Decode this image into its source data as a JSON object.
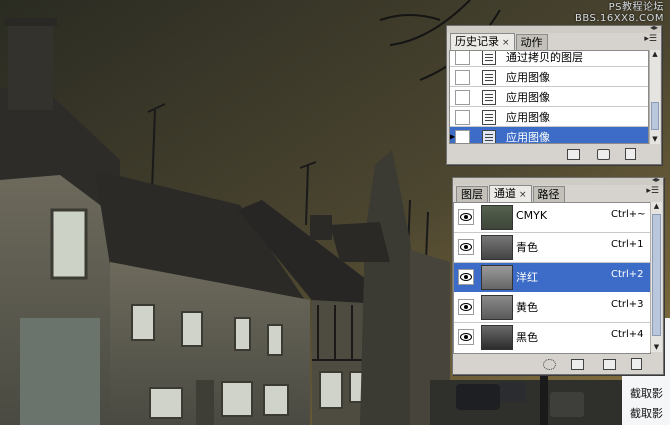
{
  "watermark": {
    "line1": "PS教程论坛",
    "line2": "BBS.16XX8.COM"
  },
  "side_text": [
    "截取影",
    "截取影"
  ],
  "history_panel": {
    "tabs": [
      {
        "label": "历史记录",
        "close": "×",
        "active": true
      },
      {
        "label": "动作",
        "active": false
      }
    ],
    "menu_icon": "panel-menu-icon",
    "items": [
      {
        "label": "通过拷贝的图层",
        "selected": false
      },
      {
        "label": "应用图像",
        "selected": false
      },
      {
        "label": "应用图像",
        "selected": false
      },
      {
        "label": "应用图像",
        "selected": false
      },
      {
        "label": "应用图像",
        "selected": true
      }
    ],
    "footer_icons": [
      "new-document-from-state-icon",
      "camera-snapshot-icon",
      "trash-icon"
    ]
  },
  "channels_panel": {
    "tabs": [
      {
        "label": "图层",
        "active": false
      },
      {
        "label": "通道",
        "close": "×",
        "active": true
      },
      {
        "label": "路径",
        "active": false
      }
    ],
    "menu_icon": "panel-menu-icon",
    "channels": [
      {
        "name": "CMYK",
        "shortcut": "Ctrl+~",
        "selected": false
      },
      {
        "name": "青色",
        "shortcut": "Ctrl+1",
        "selected": false
      },
      {
        "name": "洋红",
        "shortcut": "Ctrl+2",
        "selected": true
      },
      {
        "name": "黄色",
        "shortcut": "Ctrl+3",
        "selected": false
      },
      {
        "name": "黑色",
        "shortcut": "Ctrl+4",
        "selected": false
      }
    ],
    "footer_icons": [
      "load-selection-icon",
      "save-selection-icon",
      "new-channel-icon",
      "trash-icon"
    ]
  },
  "colors": {
    "selection": "#3c6cc7",
    "panel_bg": "#d6d3ce"
  }
}
